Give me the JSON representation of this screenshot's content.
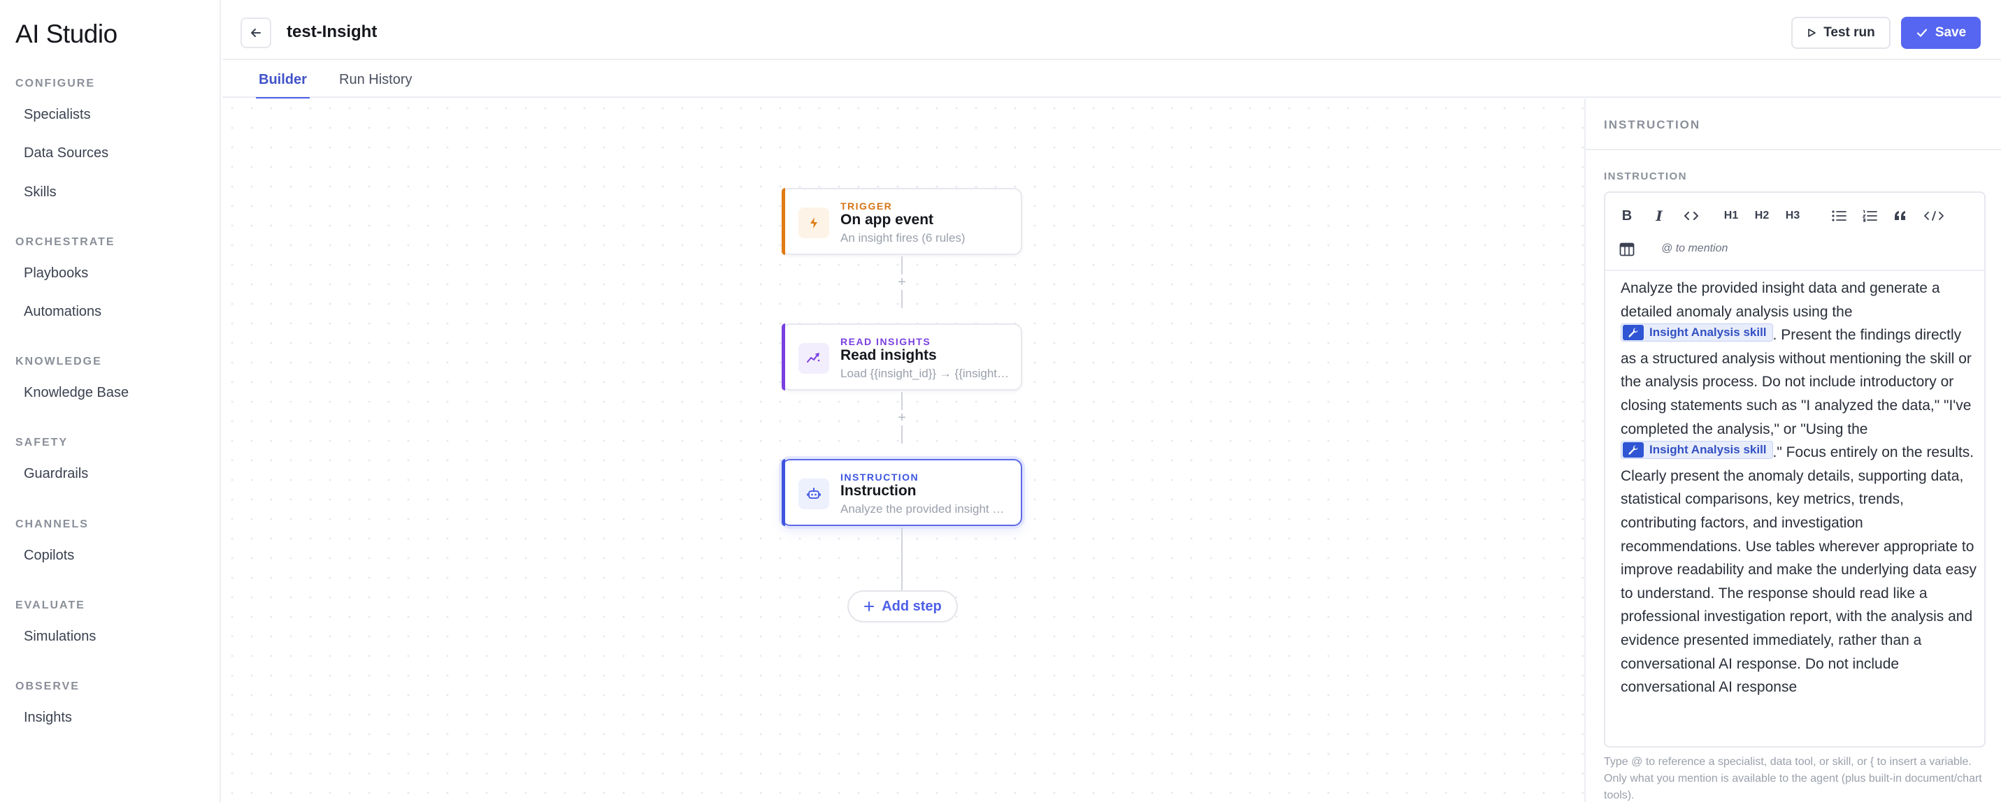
{
  "app": {
    "brand": "AI Studio"
  },
  "sidebar": {
    "sections": [
      {
        "label": "CONFIGURE",
        "items": [
          "Specialists",
          "Data Sources",
          "Skills"
        ]
      },
      {
        "label": "ORCHESTRATE",
        "items": [
          "Playbooks",
          "Automations"
        ]
      },
      {
        "label": "KNOWLEDGE",
        "items": [
          "Knowledge Base"
        ]
      },
      {
        "label": "SAFETY",
        "items": [
          "Guardrails"
        ]
      },
      {
        "label": "CHANNELS",
        "items": [
          "Copilots"
        ]
      },
      {
        "label": "EVALUATE",
        "items": [
          "Simulations"
        ]
      },
      {
        "label": "OBSERVE",
        "items": [
          "Insights"
        ]
      }
    ]
  },
  "header": {
    "title": "test-Insight",
    "test_run_label": "Test run",
    "save_label": "Save"
  },
  "tabs": [
    {
      "label": "Builder",
      "active": true
    },
    {
      "label": "Run History",
      "active": false
    }
  ],
  "flow": {
    "nodes": [
      {
        "kind": "TRIGGER",
        "name": "On app event",
        "desc": "An insight fires (6 rules)",
        "accent": "#e07a12",
        "icon": "bolt-icon"
      },
      {
        "kind": "READ INSIGHTS",
        "name": "Read insights",
        "desc": "Load {{insight_id}} → {{insights}}",
        "accent": "#7a3fe0",
        "icon": "trend-icon"
      },
      {
        "kind": "INSTRUCTION",
        "name": "Instruction",
        "desc": "Analyze the provided insight data and generate",
        "accent": "#3d55e0",
        "icon": "bot-icon"
      }
    ],
    "add_step_label": "Add step"
  },
  "panel": {
    "title": "INSTRUCTION",
    "field_label": "INSTRUCTION",
    "toolbar": {
      "h1": "H1",
      "h2": "H2",
      "h3": "H3",
      "mention_hint": "@ to mention"
    },
    "content": {
      "p1": "Analyze the provided insight data and generate a detailed anomaly analysis using the",
      "chip": "Insight Analysis skill",
      "p2": ". Present the findings directly as a structured analysis without mentioning the skill or the analysis process. Do not include introductory or closing statements such as \"I analyzed the data,\" \"I've completed the analysis,\" or \"Using the",
      "p3": ".\" Focus entirely on the results. Clearly present the anomaly details, supporting data, statistical comparisons, key metrics, trends, contributing factors, and investigation recommendations. Use tables wherever appropriate to improve readability and make the underlying data easy to understand. The response should read like a professional investigation report, with the analysis and evidence presented immediately, rather than a conversational AI response. Do not include conversational AI response"
    },
    "help_text": "Type @ to reference a specialist, data tool, or skill, or { to insert a variable. Only what you mention is available to the agent (plus built-in document/chart tools)."
  }
}
